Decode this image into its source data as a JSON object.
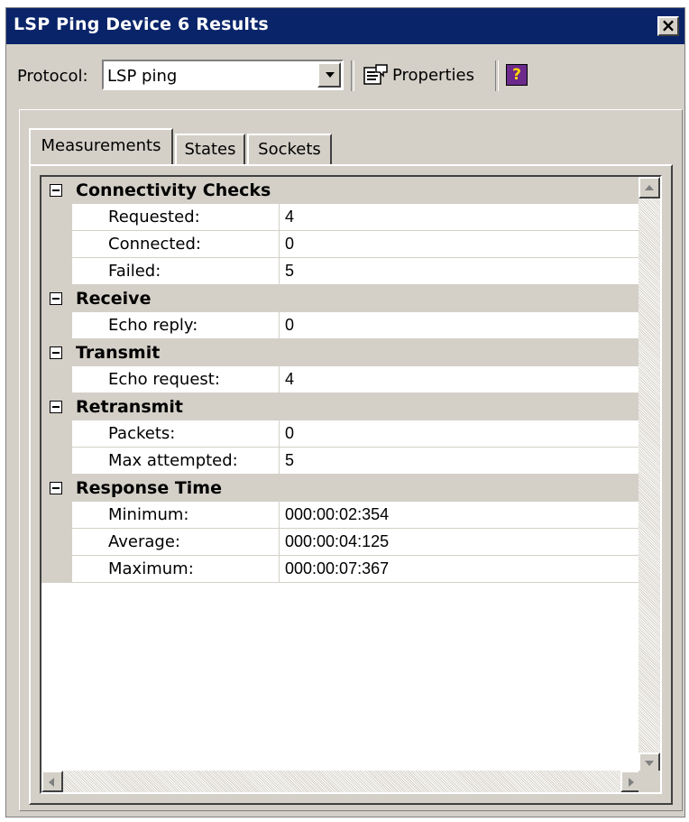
{
  "window": {
    "title": "LSP Ping Device 6 Results",
    "close_glyph": "✕"
  },
  "toolbar": {
    "protocol_label": "Protocol:",
    "protocol_value": "LSP ping",
    "properties_label": "Properties",
    "help_glyph": "?"
  },
  "tabs": [
    {
      "label": "Measurements",
      "active": true
    },
    {
      "label": "States",
      "active": false
    },
    {
      "label": "Sockets",
      "active": false
    }
  ],
  "grid": {
    "categories": [
      {
        "name": "Connectivity Checks",
        "rows": [
          {
            "name": "Requested:",
            "value": "4"
          },
          {
            "name": "Connected:",
            "value": "0"
          },
          {
            "name": "Failed:",
            "value": "5"
          }
        ]
      },
      {
        "name": "Receive",
        "rows": [
          {
            "name": "Echo reply:",
            "value": "0"
          }
        ]
      },
      {
        "name": "Transmit",
        "rows": [
          {
            "name": "Echo request:",
            "value": "4"
          }
        ]
      },
      {
        "name": "Retransmit",
        "rows": [
          {
            "name": "Packets:",
            "value": "0"
          },
          {
            "name": "Max attempted:",
            "value": "5"
          }
        ]
      },
      {
        "name": "Response Time",
        "rows": [
          {
            "name": "Minimum:",
            "value": "000:00:02:354"
          },
          {
            "name": "Average:",
            "value": "000:00:04:125"
          },
          {
            "name": "Maximum:",
            "value": "000:00:07:367"
          }
        ]
      }
    ]
  },
  "colors": {
    "title_bar": "#0a246a",
    "face": "#d4d0c8",
    "help_icon": "#6b2a8c"
  },
  "icons": {
    "properties": "properties-sheet-icon",
    "help": "help-book-icon",
    "collapse": "collapse-minus-icon"
  }
}
